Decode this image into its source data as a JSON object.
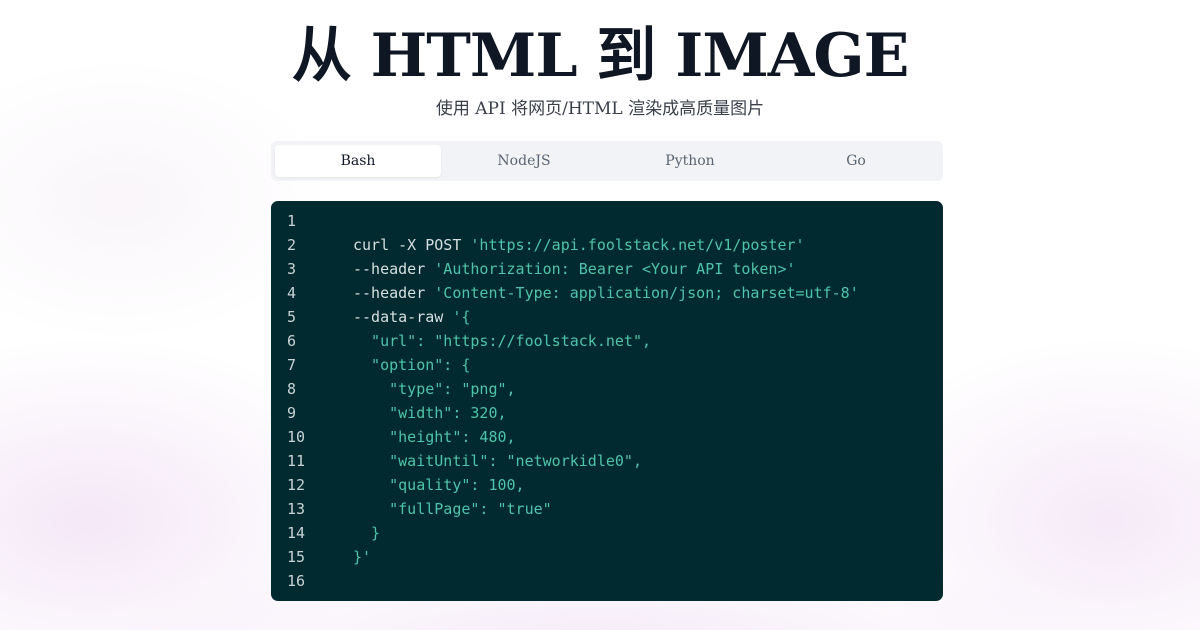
{
  "header": {
    "title": "从 HTML 到 IMAGE",
    "subtitle": "使用 API 将网页/HTML 渲染成高质量图片"
  },
  "tabs": [
    {
      "label": "Bash",
      "active": true
    },
    {
      "label": "NodeJS",
      "active": false
    },
    {
      "label": "Python",
      "active": false
    },
    {
      "label": "Go",
      "active": false
    }
  ],
  "code": {
    "language": "bash",
    "lines": [
      {
        "num": "1",
        "tokens": []
      },
      {
        "num": "2",
        "tokens": [
          {
            "t": "curl -X POST ",
            "c": "plain"
          },
          {
            "t": "'https://api.foolstack.net/v1/poster'",
            "c": "str"
          }
        ]
      },
      {
        "num": "3",
        "tokens": [
          {
            "t": "--header ",
            "c": "plain"
          },
          {
            "t": "'Authorization: Bearer <Your API token>'",
            "c": "str"
          }
        ]
      },
      {
        "num": "4",
        "tokens": [
          {
            "t": "--header ",
            "c": "plain"
          },
          {
            "t": "'Content-Type: application/json; charset=utf-8'",
            "c": "str"
          }
        ]
      },
      {
        "num": "5",
        "tokens": [
          {
            "t": "--data-raw ",
            "c": "plain"
          },
          {
            "t": "'{",
            "c": "str"
          }
        ]
      },
      {
        "num": "6",
        "tokens": [
          {
            "t": "  \"url\": \"https://foolstack.net\",",
            "c": "str"
          }
        ]
      },
      {
        "num": "7",
        "tokens": [
          {
            "t": "  \"option\": {",
            "c": "str"
          }
        ]
      },
      {
        "num": "8",
        "tokens": [
          {
            "t": "    \"type\": \"png\",",
            "c": "str"
          }
        ]
      },
      {
        "num": "9",
        "tokens": [
          {
            "t": "    \"width\": 320,",
            "c": "str"
          }
        ]
      },
      {
        "num": "10",
        "tokens": [
          {
            "t": "    \"height\": 480,",
            "c": "str"
          }
        ]
      },
      {
        "num": "11",
        "tokens": [
          {
            "t": "    \"waitUntil\": \"networkidle0\",",
            "c": "str"
          }
        ]
      },
      {
        "num": "12",
        "tokens": [
          {
            "t": "    \"quality\": 100,",
            "c": "str"
          }
        ]
      },
      {
        "num": "13",
        "tokens": [
          {
            "t": "    \"fullPage\": \"true\"",
            "c": "str"
          }
        ]
      },
      {
        "num": "14",
        "tokens": [
          {
            "t": "  }",
            "c": "str"
          }
        ]
      },
      {
        "num": "15",
        "tokens": [
          {
            "t": "}'",
            "c": "str"
          }
        ]
      },
      {
        "num": "16",
        "tokens": []
      }
    ]
  },
  "colors": {
    "code_background": "#012a30",
    "code_string": "#4fc3a9",
    "code_text": "#d6dfe1",
    "title_text": "#0f1724",
    "tab_bar": "#f1f3f6"
  }
}
